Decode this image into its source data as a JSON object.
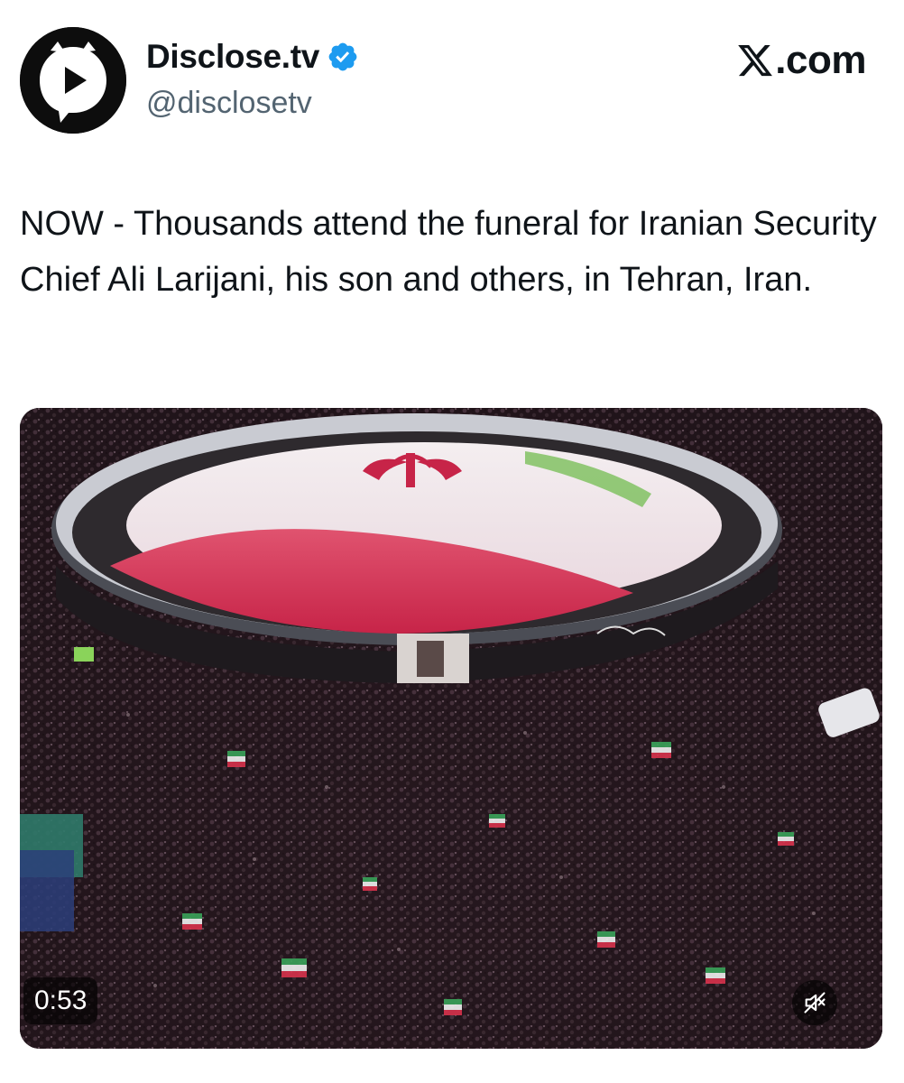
{
  "author": {
    "display_name": "Disclose.tv",
    "handle": "@disclosetv",
    "verified": true,
    "avatar_icon": "play-speech-bubble-icon",
    "verified_color": "#1d9bf0"
  },
  "source": {
    "label": ".com",
    "logo_icon": "x-logo-icon"
  },
  "tweet": {
    "text": "NOW - Thousands attend the funeral for Iranian Security Chief Ali Larijani, his son and others, in Tehran, Iran."
  },
  "video": {
    "duration": "0:53",
    "muted": true,
    "mute_icon": "speaker-muted-icon"
  }
}
